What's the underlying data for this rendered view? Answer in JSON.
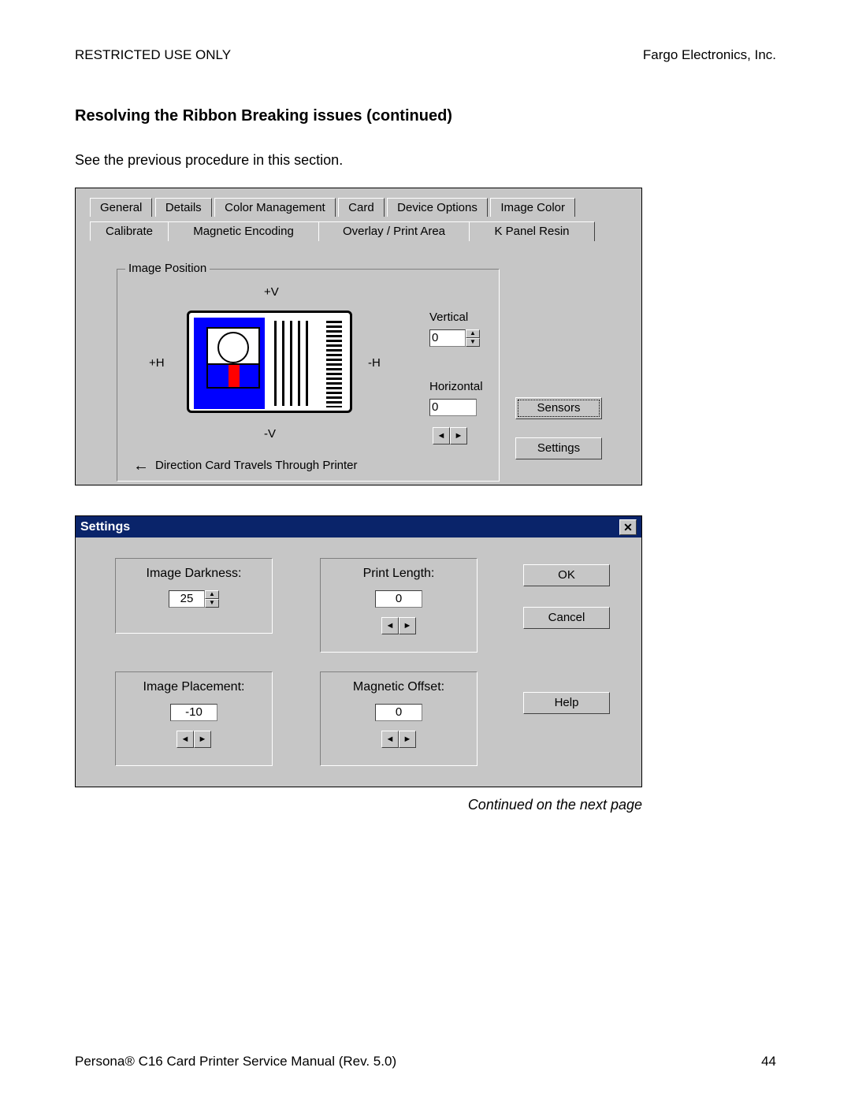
{
  "header": {
    "left": "RESTRICTED USE ONLY",
    "right": "Fargo Electronics, Inc."
  },
  "title": "Resolving the Ribbon Breaking issues (continued)",
  "intro": "See the previous procedure in this section.",
  "calibrate": {
    "tabs_row1": [
      "General",
      "Details",
      "Color Management",
      "Card",
      "Device Options",
      "Image Color"
    ],
    "tabs_row2": [
      "Calibrate",
      "Magnetic Encoding",
      "Overlay / Print Area",
      "K Panel Resin"
    ],
    "active_tab": "Calibrate",
    "group_label": "Image Position",
    "axis": {
      "plusV": "+V",
      "minusV": "-V",
      "plusH": "+H",
      "minusH": "-H"
    },
    "direction_text": "Direction Card Travels Through Printer",
    "vertical_label": "Vertical",
    "vertical_value": "0",
    "horizontal_label": "Horizontal",
    "horizontal_value": "0",
    "sensors_btn": "Sensors",
    "settings_btn": "Settings"
  },
  "settings_dialog": {
    "title": "Settings",
    "image_darkness_label": "Image Darkness:",
    "image_darkness_value": "25",
    "print_length_label": "Print Length:",
    "print_length_value": "0",
    "image_placement_label": "Image Placement:",
    "image_placement_value": "-10",
    "magnetic_offset_label": "Magnetic Offset:",
    "magnetic_offset_value": "0",
    "ok": "OK",
    "cancel": "Cancel",
    "help": "Help"
  },
  "continued": "Continued on the next page",
  "footer": {
    "left": "Persona® C16 Card Printer Service Manual (Rev. 5.0)",
    "right": "44"
  }
}
